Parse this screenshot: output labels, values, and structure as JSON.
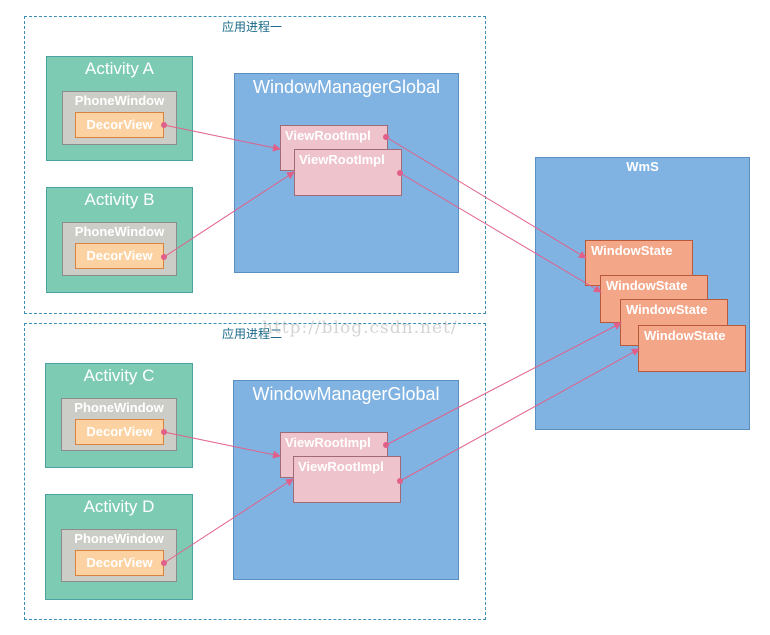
{
  "processes": [
    {
      "label": "应用进程一",
      "activities": [
        {
          "title": "Activity A",
          "phone_window": "PhoneWindow",
          "decor_view": "DecorView"
        },
        {
          "title": "Activity B",
          "phone_window": "PhoneWindow",
          "decor_view": "DecorView"
        }
      ],
      "window_manager_global": "WindowManagerGlobal",
      "view_root_impls": [
        "ViewRootImpl",
        "ViewRootImpl"
      ]
    },
    {
      "label": "应用进程二",
      "activities": [
        {
          "title": "Activity C",
          "phone_window": "PhoneWindow",
          "decor_view": "DecorView"
        },
        {
          "title": "Activity D",
          "phone_window": "PhoneWindow",
          "decor_view": "DecorView"
        }
      ],
      "window_manager_global": "WindowManagerGlobal",
      "view_root_impls": [
        "ViewRootImpl",
        "ViewRootImpl"
      ]
    }
  ],
  "wms": {
    "title": "WmS",
    "window_states": [
      "WindowState",
      "WindowState",
      "WindowState",
      "WindowState"
    ]
  },
  "watermark": "http://blog.csdn.net/",
  "colors": {
    "connector": "#e0608a",
    "activity": "#7ecbb3",
    "window_manager": "#80b3e2",
    "view_root_impl": "#efc3cc",
    "window_state": "#f3a688",
    "decor_view": "#fdd2a2"
  }
}
